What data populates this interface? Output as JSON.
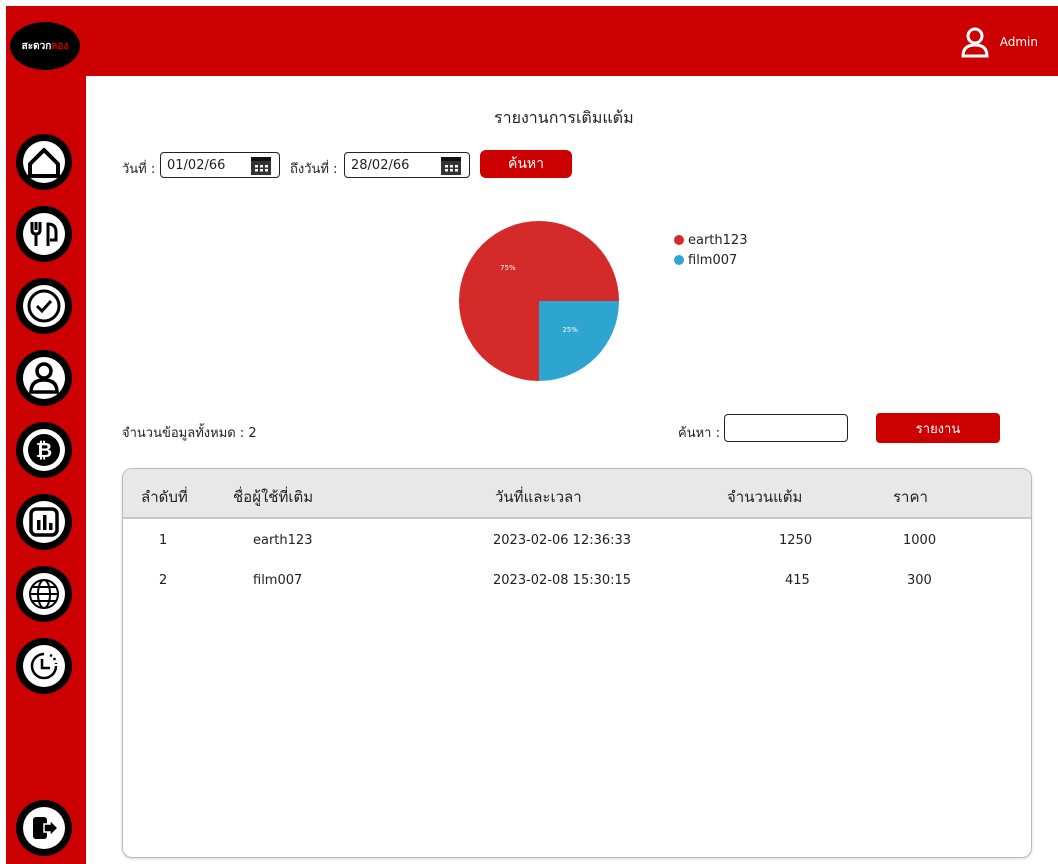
{
  "app": {
    "logo_text_white": "สะดวก",
    "logo_text_red": "ลอง",
    "user_label": "Admin"
  },
  "sidebar": {
    "items": [
      {
        "icon": "home-icon"
      },
      {
        "icon": "food-icon"
      },
      {
        "icon": "check-icon"
      },
      {
        "icon": "user-icon"
      },
      {
        "icon": "bitcoin-icon"
      },
      {
        "icon": "chart-icon"
      },
      {
        "icon": "globe-icon"
      },
      {
        "icon": "history-icon"
      },
      {
        "icon": "logout-icon"
      }
    ]
  },
  "page": {
    "title": "รายงานการเติมแต้ม",
    "from_label": "วันที่ :",
    "from_value": "01/02/66",
    "to_label": "ถึงวันที่ :",
    "to_value": "28/02/66",
    "search_button": "ค้นหา",
    "total_label": "จำนวนข้อมูลทั้งหมด : 2",
    "search_label": "ค้นหา :",
    "search_value": "",
    "report_button": "รายงาน"
  },
  "chart_data": {
    "type": "pie",
    "categories": [
      "earth123",
      "film007"
    ],
    "values": [
      75,
      25
    ],
    "labels": [
      "75%",
      "25%"
    ],
    "colors": [
      "#d42a2a",
      "#2ea4d0"
    ],
    "legend_position": "right"
  },
  "table": {
    "headers": [
      "ลำดับที่",
      "ชื่อผู้ใช้ที่เติม",
      "วันที่และเวลา",
      "จำนวนแต้ม",
      "ราคา"
    ],
    "rows": [
      [
        "1",
        "earth123",
        "2023-02-06 12:36:33",
        "1250",
        "1000"
      ],
      [
        "2",
        "film007",
        "2023-02-08 15:30:15",
        "415",
        "300"
      ]
    ]
  }
}
